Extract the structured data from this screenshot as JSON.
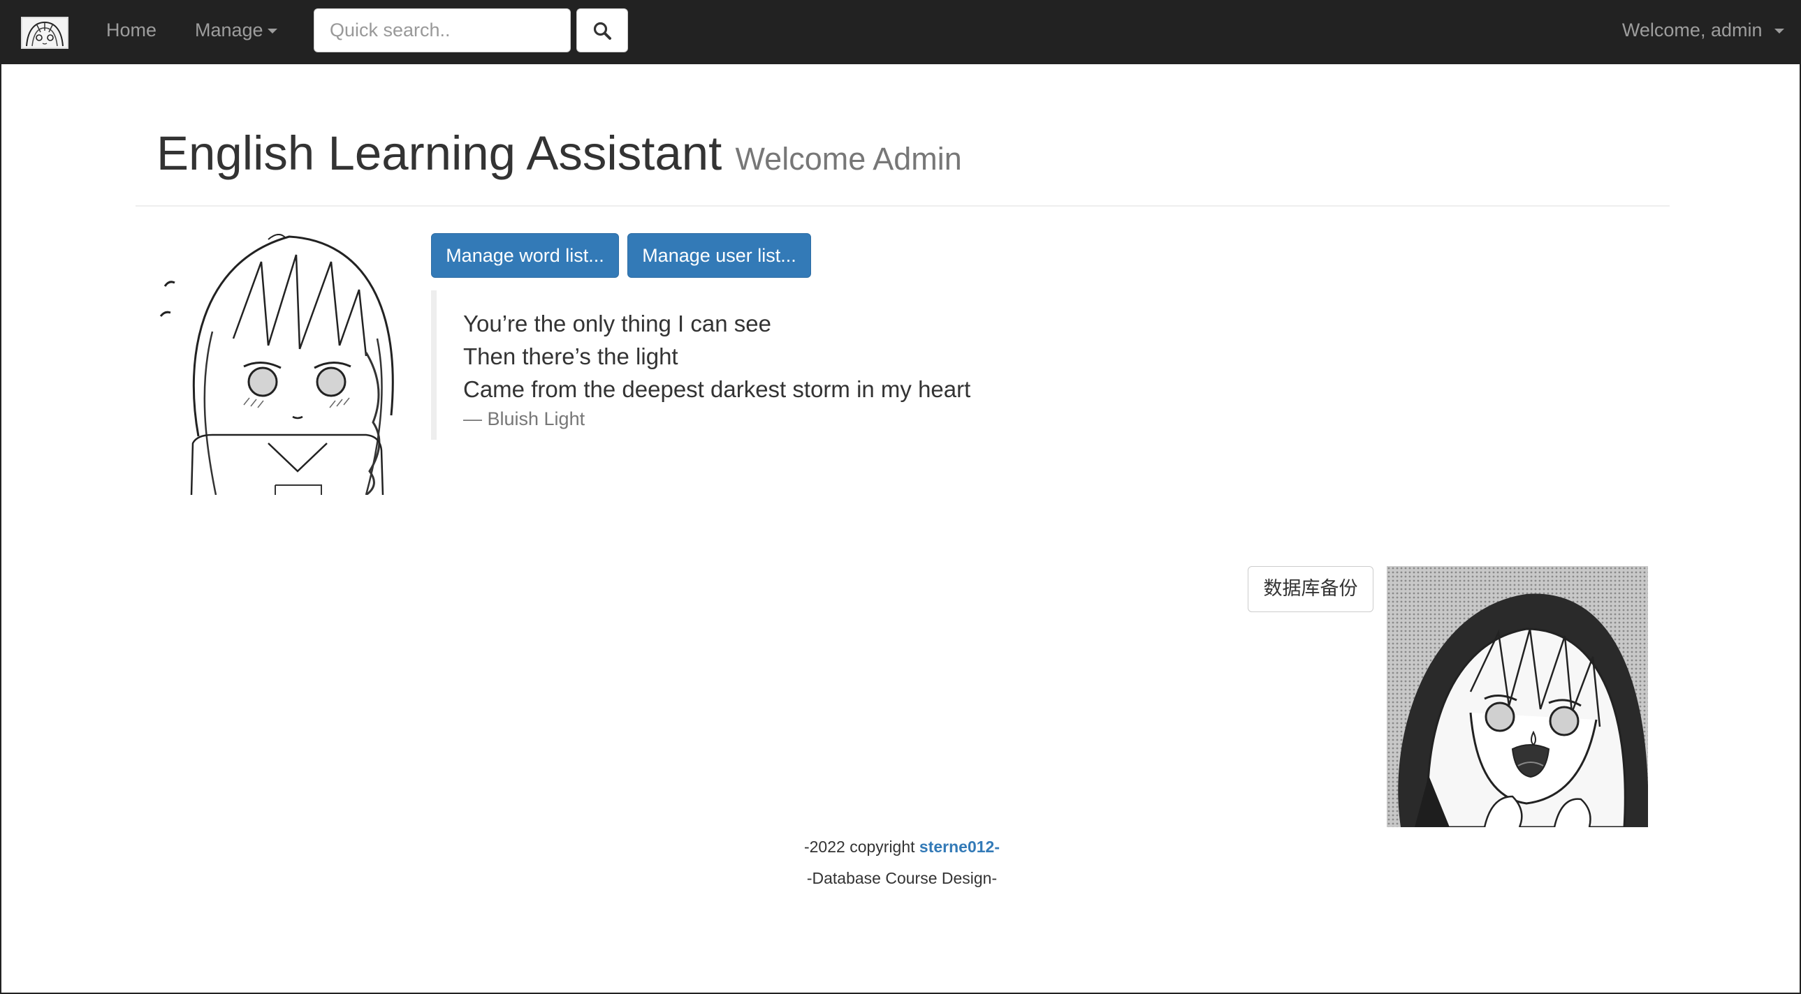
{
  "navbar": {
    "brand_icon": "anime-girl-logo",
    "home_label": "Home",
    "manage_label": "Manage",
    "search_placeholder": "Quick search..",
    "search_icon": "search-icon",
    "user_menu_label": "Welcome, admin"
  },
  "header": {
    "title": "English Learning Assistant",
    "subtitle": "Welcome Admin"
  },
  "actions": {
    "manage_words_label": "Manage word list...",
    "manage_users_label": "Manage user list...",
    "backup_label": "数据库备份"
  },
  "quote": {
    "lines": [
      "You’re the only thing I can see",
      "Then there’s the light",
      "Came from the deepest darkest storm in my heart"
    ],
    "source": "— Bluish Light"
  },
  "footer": {
    "copyright_prefix": "-2022 copyright ",
    "author": "sterne012",
    "copyright_suffix": "-",
    "course": "-Database Course Design-"
  },
  "colors": {
    "navbar_bg": "#222222",
    "primary": "#337ab7",
    "link": "#337ab7"
  }
}
